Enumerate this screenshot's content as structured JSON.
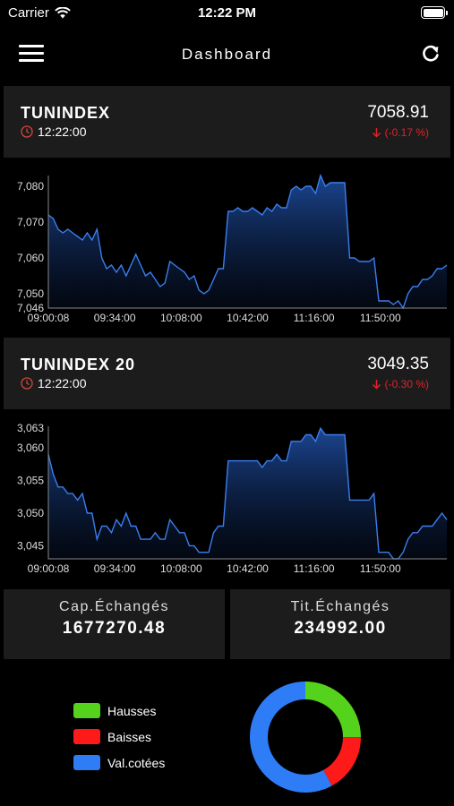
{
  "status": {
    "carrier": "Carrier",
    "time": "12:22 PM"
  },
  "nav": {
    "title": "Dashboard"
  },
  "indices": [
    {
      "name": "TUNINDEX",
      "time": "12:22:00",
      "value": "7058.91",
      "change": "(-0.17 %)"
    },
    {
      "name": "TUNINDEX 20",
      "time": "12:22:00",
      "value": "3049.35",
      "change": "(-0.30 %)"
    }
  ],
  "stats": {
    "cap_label": "Cap.Échangés",
    "cap_value": "1677270.48",
    "tit_label": "Tit.Échangés",
    "tit_value": "234992.00"
  },
  "legend": [
    {
      "label": "Hausses",
      "color": "#55d21c"
    },
    {
      "label": "Baisses",
      "color": "#ff1a1a"
    },
    {
      "label": "Val.cotées",
      "color": "#2f7df6"
    }
  ],
  "donut_fractions": {
    "Hausses": 0.25,
    "Baisses": 0.17,
    "Val.cotées": 0.58
  },
  "chart_data": [
    {
      "type": "area",
      "x_labels": [
        "09:00:08",
        "09:34:00",
        "10:08:00",
        "10:42:00",
        "11:16:00",
        "11:50:00"
      ],
      "y_ticks": [
        7080,
        7070,
        7060,
        7050,
        7046
      ],
      "ylim": [
        7046,
        7083
      ],
      "values": [
        7072,
        7071,
        7068,
        7067,
        7068,
        7067,
        7066,
        7065,
        7067,
        7065,
        7068,
        7060,
        7057,
        7058,
        7056,
        7058,
        7055,
        7058,
        7061,
        7058,
        7055,
        7056,
        7054,
        7052,
        7053,
        7059,
        7058,
        7057,
        7056,
        7054,
        7055,
        7051,
        7050,
        7051,
        7054,
        7057,
        7057,
        7073,
        7073,
        7074,
        7073,
        7073,
        7074,
        7073,
        7072,
        7074,
        7073,
        7075,
        7074,
        7074,
        7079,
        7080,
        7079,
        7080,
        7080,
        7078,
        7083,
        7080,
        7081,
        7081,
        7081,
        7081,
        7060,
        7060,
        7059,
        7059,
        7059,
        7060,
        7048,
        7048,
        7048,
        7047,
        7048,
        7046,
        7050,
        7052,
        7052,
        7054,
        7054,
        7055,
        7057,
        7057,
        7058
      ]
    },
    {
      "type": "area",
      "x_labels": [
        "09:00:08",
        "09:34:00",
        "10:08:00",
        "10:42:00",
        "11:16:00",
        "11:50:00"
      ],
      "y_ticks": [
        3063,
        3060,
        3055,
        3050,
        3045
      ],
      "ylim": [
        3043,
        3063.3
      ],
      "values": [
        3059,
        3056,
        3054,
        3054,
        3053,
        3053,
        3052,
        3053,
        3050,
        3050,
        3046,
        3048,
        3048,
        3047,
        3049,
        3048,
        3050,
        3048,
        3048,
        3046,
        3046,
        3046,
        3047,
        3046,
        3046,
        3049,
        3048,
        3047,
        3047,
        3045,
        3045,
        3044,
        3044,
        3044,
        3047,
        3048,
        3048,
        3058,
        3058,
        3058,
        3058,
        3058,
        3058,
        3058,
        3057,
        3058,
        3058,
        3059,
        3058,
        3058,
        3061,
        3061,
        3061,
        3062,
        3062,
        3061,
        3063,
        3062,
        3062,
        3062,
        3062,
        3062,
        3052,
        3052,
        3052,
        3052,
        3052,
        3053,
        3044,
        3044,
        3044,
        3043,
        3043,
        3044,
        3046,
        3047,
        3047,
        3048,
        3048,
        3048,
        3049,
        3050,
        3049
      ]
    }
  ]
}
